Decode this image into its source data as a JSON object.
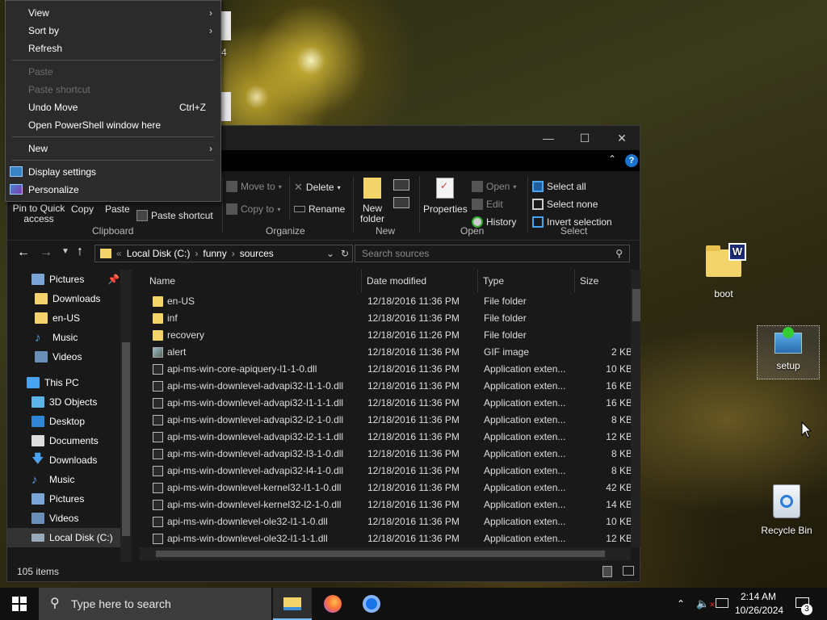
{
  "desktop": {
    "icons": [
      {
        "label": "boot"
      },
      {
        "label": "setup"
      },
      {
        "label": "Recycle Bin"
      }
    ],
    "partial_label_4": "4"
  },
  "context_menu": {
    "items": [
      {
        "label": "View",
        "submenu": true
      },
      {
        "label": "Sort by",
        "submenu": true
      },
      {
        "label": "Refresh"
      },
      {
        "label": "Paste",
        "disabled": true
      },
      {
        "label": "Paste shortcut",
        "disabled": true
      },
      {
        "label": "Undo Move",
        "shortcut": "Ctrl+Z"
      },
      {
        "label": "Open PowerShell window here"
      },
      {
        "label": "New",
        "submenu": true
      },
      {
        "label": "Display settings"
      },
      {
        "label": "Personalize"
      }
    ]
  },
  "explorer": {
    "ribbon": {
      "clipboard": {
        "pin": "Pin to Quick access",
        "copy": "Copy",
        "paste": "Paste",
        "paste_shortcut": "Paste shortcut",
        "group": "Clipboard"
      },
      "organize": {
        "move_to": "Move to",
        "copy_to": "Copy to",
        "delete": "Delete",
        "rename": "Rename",
        "group": "Organize"
      },
      "new": {
        "new_folder": "New folder",
        "group": "New"
      },
      "open": {
        "properties": "Properties",
        "open": "Open",
        "edit": "Edit",
        "history": "History",
        "group": "Open"
      },
      "select": {
        "select_all": "Select all",
        "select_none": "Select none",
        "invert": "Invert selection",
        "group": "Select"
      }
    },
    "address": {
      "crumbs": [
        "Local Disk (C:)",
        "funny",
        "sources"
      ]
    },
    "search": {
      "placeholder": "Search sources"
    },
    "nav": [
      {
        "label": "Pictures",
        "pinned": true
      },
      {
        "label": "Downloads"
      },
      {
        "label": "en-US"
      },
      {
        "label": "Music"
      },
      {
        "label": "Videos"
      },
      {
        "label": "This PC"
      },
      {
        "label": "3D Objects"
      },
      {
        "label": "Desktop"
      },
      {
        "label": "Documents"
      },
      {
        "label": "Downloads"
      },
      {
        "label": "Music"
      },
      {
        "label": "Pictures"
      },
      {
        "label": "Videos"
      },
      {
        "label": "Local Disk (C:)"
      }
    ],
    "columns": {
      "name": "Name",
      "date": "Date modified",
      "type": "Type",
      "size": "Size"
    },
    "files": [
      {
        "name": "en-US",
        "date": "12/18/2016 11:36 PM",
        "type": "File folder",
        "size": "",
        "kind": "folder"
      },
      {
        "name": "inf",
        "date": "12/18/2016 11:36 PM",
        "type": "File folder",
        "size": "",
        "kind": "folder"
      },
      {
        "name": "recovery",
        "date": "12/18/2016 11:26 PM",
        "type": "File folder",
        "size": "",
        "kind": "folder"
      },
      {
        "name": "alert",
        "date": "12/18/2016 11:36 PM",
        "type": "GIF image",
        "size": "2 KB",
        "kind": "gif"
      },
      {
        "name": "api-ms-win-core-apiquery-l1-1-0.dll",
        "date": "12/18/2016 11:36 PM",
        "type": "Application exten...",
        "size": "10 KB",
        "kind": "file"
      },
      {
        "name": "api-ms-win-downlevel-advapi32-l1-1-0.dll",
        "date": "12/18/2016 11:36 PM",
        "type": "Application exten...",
        "size": "16 KB",
        "kind": "file"
      },
      {
        "name": "api-ms-win-downlevel-advapi32-l1-1-1.dll",
        "date": "12/18/2016 11:36 PM",
        "type": "Application exten...",
        "size": "16 KB",
        "kind": "file"
      },
      {
        "name": "api-ms-win-downlevel-advapi32-l2-1-0.dll",
        "date": "12/18/2016 11:36 PM",
        "type": "Application exten...",
        "size": "8 KB",
        "kind": "file"
      },
      {
        "name": "api-ms-win-downlevel-advapi32-l2-1-1.dll",
        "date": "12/18/2016 11:36 PM",
        "type": "Application exten...",
        "size": "12 KB",
        "kind": "file"
      },
      {
        "name": "api-ms-win-downlevel-advapi32-l3-1-0.dll",
        "date": "12/18/2016 11:36 PM",
        "type": "Application exten...",
        "size": "8 KB",
        "kind": "file"
      },
      {
        "name": "api-ms-win-downlevel-advapi32-l4-1-0.dll",
        "date": "12/18/2016 11:36 PM",
        "type": "Application exten...",
        "size": "8 KB",
        "kind": "file"
      },
      {
        "name": "api-ms-win-downlevel-kernel32-l1-1-0.dll",
        "date": "12/18/2016 11:36 PM",
        "type": "Application exten...",
        "size": "42 KB",
        "kind": "file"
      },
      {
        "name": "api-ms-win-downlevel-kernel32-l2-1-0.dll",
        "date": "12/18/2016 11:36 PM",
        "type": "Application exten...",
        "size": "14 KB",
        "kind": "file"
      },
      {
        "name": "api-ms-win-downlevel-ole32-l1-1-0.dll",
        "date": "12/18/2016 11:36 PM",
        "type": "Application exten...",
        "size": "10 KB",
        "kind": "file"
      },
      {
        "name": "api-ms-win-downlevel-ole32-l1-1-1.dll",
        "date": "12/18/2016 11:36 PM",
        "type": "Application exten...",
        "size": "12 KB",
        "kind": "file"
      }
    ],
    "status": {
      "count": "105 items"
    }
  },
  "taskbar": {
    "search_placeholder": "Type here to search",
    "clock_time": "2:14 AM",
    "clock_date": "10/26/2024",
    "notification_count": "3"
  },
  "colors": {
    "accent": "#0078d7",
    "window_bg": "#191919",
    "folder": "#f3d46b",
    "menu_bg": "#2b2b2b"
  }
}
